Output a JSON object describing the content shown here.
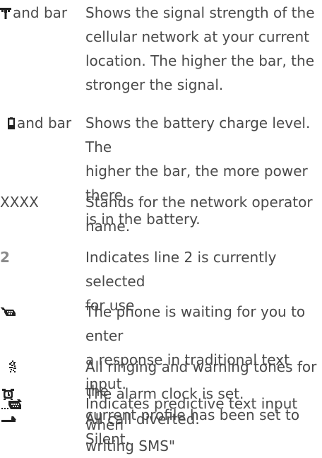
{
  "entries": [
    {
      "icon": "signal-antenna-icon",
      "term": " and bar",
      "desc": "Shows the signal strength of the\ncellular network at your current\nlocation. The higher the bar, the\nstronger the signal."
    },
    {
      "icon": "battery-icon",
      "term": " and bar",
      "desc": "Shows the battery charge level. The\nhigher the bar, the more power there\nis in the battery."
    },
    {
      "icon": "",
      "term": "XXXX",
      "desc": "Stands for the network operator\nname."
    },
    {
      "icon": "",
      "term": "2",
      "desc": "Indicates line 2 is currently selected\nfor use"
    },
    {
      "icon": "traditional-text-input-icon",
      "term": "",
      "desc": "The phone is waiting for you to enter\na response in traditional text input."
    },
    {
      "icon": "silent-profile-icon",
      "term": "",
      "desc": "All ringing and warning tones for the\ncurrent profile has been set to Silent."
    },
    {
      "icon": "alarm-clock-icon",
      "term": "",
      "desc": "The alarm clock is set."
    },
    {
      "icon": "call-divert-icon",
      "term": "",
      "desc": "All call diverted."
    },
    {
      "icon": "predictive-text-input-icon",
      "term": "",
      "desc": "Indicates predictive text input when\nwriting SMS\""
    }
  ]
}
